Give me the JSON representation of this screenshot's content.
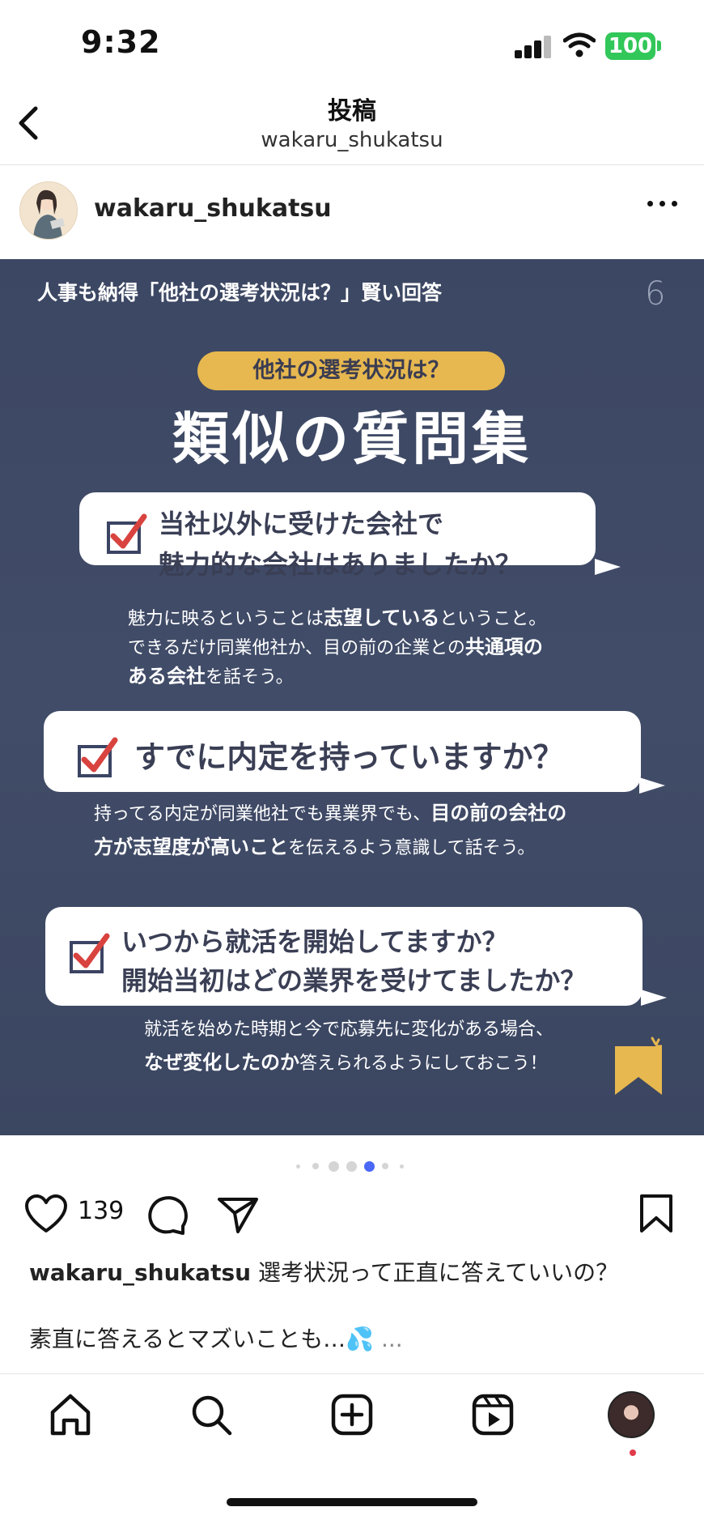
{
  "status": {
    "time": "9:32",
    "battery": "100"
  },
  "header": {
    "title": "投稿",
    "subtitle": "wakaru_shukatsu",
    "back_icon": "chevron-left-icon"
  },
  "post": {
    "username": "wakaru_shukatsu",
    "slide": {
      "header": "人事も納得「他社の選考状況は？」賢い回答",
      "page_number": "6",
      "pill": "他社の選考状況は？",
      "title": "類似の質問集",
      "items": [
        {
          "q1": "当社以外に受けた会社で",
          "q2": "魅力的な会社はありましたか？",
          "n1a": "魅力に映るということは",
          "n1b": "志望している",
          "n1c": "ということ。",
          "n2a": "できるだけ同業他社か、目の前の企業との",
          "n2b": "共通項の",
          "n3a": "ある会社",
          "n3b": "を話そう。"
        },
        {
          "q1": "すでに内定を持っていますか？",
          "n1a": "持ってる内定が同業他社でも異業界でも、",
          "n1b": "目の前の会社の",
          "n2a": "方が志望度が高いこと",
          "n2b": "を伝えるよう意識して話そう。"
        },
        {
          "q1": "いつから就活を開始してますか？",
          "q2": "開始当初はどの業界を受けてましたか？",
          "n1a": "就活を始めた時期と今で応募先に変化がある場合、",
          "n2a": "なぜ変化したのか",
          "n2b": "答えられるようにしておこう！"
        }
      ]
    },
    "likes": "139",
    "caption_user": "wakaru_shukatsu",
    "caption_text": "選考状況って正直に答えていいの？",
    "caption_line2": "素直に答えるとマズいことも…💦",
    "more_text": "..."
  },
  "carousel": {
    "count": 7,
    "active": 4
  },
  "colors": {
    "slide_bg": "#3c4763",
    "accent": "#e7b84f",
    "check_red": "#d9433f",
    "active_dot": "#4a67f5",
    "battery": "#32c759"
  }
}
